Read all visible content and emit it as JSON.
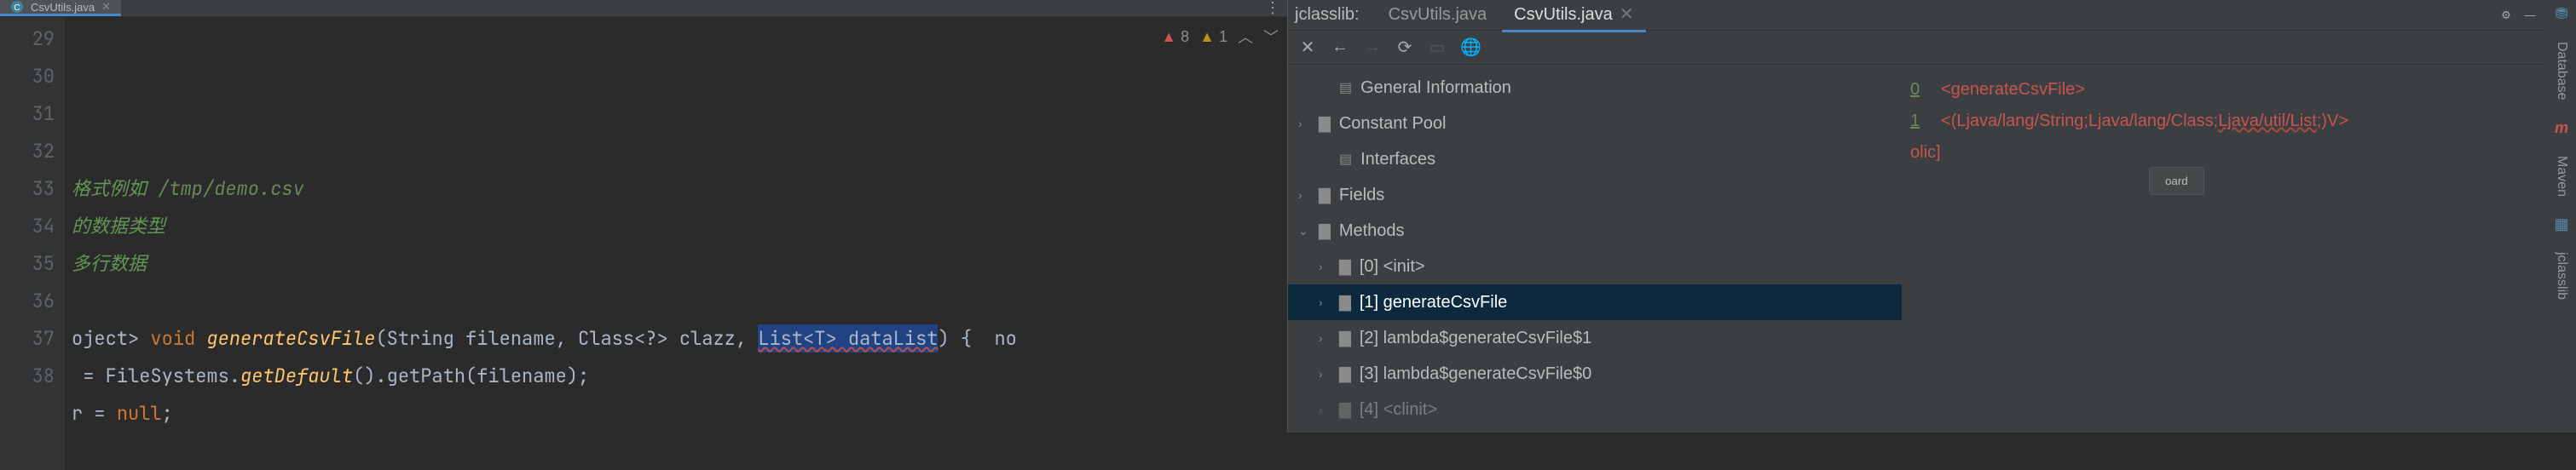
{
  "editor": {
    "tab": {
      "filename": "CsvUtils.java"
    },
    "lines": [
      "29",
      "30",
      "31",
      "32",
      "33",
      "34",
      "35",
      "36",
      "37",
      "38"
    ],
    "code": {
      "l32a": "格式例如 ",
      "l32b": "/tmp/demo.csv",
      "l33": "的数据类型",
      "l34": "多行数据",
      "l36a": "oject> ",
      "l36b": "void",
      "l36c": " ",
      "l36d": "generateCsvFile",
      "l36e": "(String filename, Class<?> clazz, ",
      "l36f": "List<T> dataList",
      "l36f1": "List<",
      "l36f2": "T",
      "l36f3": "> dataList",
      "l36g": ") {  no",
      "l37a": " = FileSystems.",
      "l37b": "getDefault",
      "l37c": "().getPath(filename);",
      "l38a": "r = ",
      "l38b": "null",
      "l38c": ";"
    },
    "inspections": {
      "errors": "8",
      "warnings": "1"
    }
  },
  "jclasslib": {
    "label": "jclasslib:",
    "tabs": [
      {
        "name": "CsvUtils.java",
        "active": false
      },
      {
        "name": "CsvUtils.java",
        "active": true
      }
    ],
    "tree": {
      "general": "General Information",
      "constpool": "Constant Pool",
      "interfaces": "Interfaces",
      "fields": "Fields",
      "methods": "Methods",
      "m0": "[0] <init>",
      "m1": "[1] generateCsvFile",
      "m2": "[2] lambda$generateCsvFile$1",
      "m3": "[3] lambda$generateCsvFile$0",
      "m4": "[4] <clinit>"
    },
    "detail": {
      "idx0": "0",
      "val0": "<generateCsvFile>",
      "idx1": "1",
      "val1a": "<(Ljava/lang/String;Ljava/lang/Class;",
      "val1b": "Ljava/util/List;",
      "val1c": ")V>",
      "tag": "olic]",
      "button": "oard"
    }
  },
  "dock": {
    "database": "Database",
    "maven": "Maven",
    "jclasslib": "jclasslib"
  }
}
